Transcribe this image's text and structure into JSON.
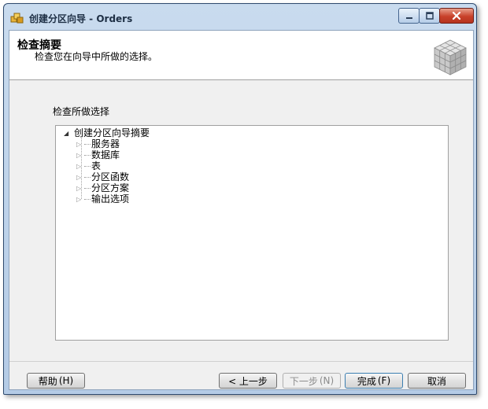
{
  "window": {
    "title": "创建分区向导 - Orders"
  },
  "header": {
    "title": "检查摘要",
    "subtitle": "检查您在向导中所做的选择。"
  },
  "main": {
    "section_label": "检查所做选择",
    "tree": {
      "root_label": "创建分区向导摘要",
      "items": [
        {
          "label": "服务器"
        },
        {
          "label": "数据库"
        },
        {
          "label": "表"
        },
        {
          "label": "分区函数"
        },
        {
          "label": "分区方案"
        },
        {
          "label": "输出选项"
        }
      ]
    }
  },
  "footer": {
    "help_label": "帮助",
    "help_key": "(H)",
    "back_label": "< 上一步",
    "next_label": "下一步",
    "next_key": "(N)",
    "finish_label": "完成",
    "finish_key": "(F)",
    "cancel_label": "取消"
  },
  "icons": {
    "app": "wizard-app-icon",
    "header_graphic": "cube-grid-icon",
    "tree_expanded": "triangle-expanded-icon",
    "tree_collapsed": "triangle-collapsed-icon"
  }
}
